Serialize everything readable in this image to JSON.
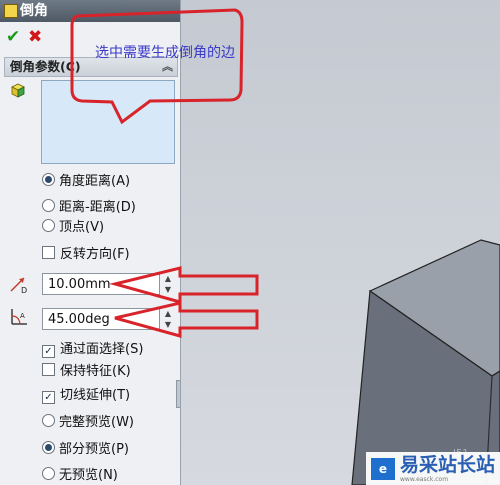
{
  "panel": {
    "title": "倒角",
    "ok_icon": "check-icon",
    "cancel_icon": "close-icon",
    "group_title": "倒角参数(C)",
    "collapse_icon": "double-chevron-up-icon",
    "edge_selection_icon": "cube-edge-icon",
    "type_options": [
      {
        "label": "角度距离(A)",
        "selected": true
      },
      {
        "label": "距离-距离(D)",
        "selected": false
      },
      {
        "label": "顶点(V)",
        "selected": false
      }
    ],
    "flip_direction": {
      "label": "反转方向(F)",
      "checked": false
    },
    "distance": {
      "value": "10.00mm",
      "icon": "distance-icon"
    },
    "angle": {
      "value": "45.00deg",
      "icon": "angle-icon"
    },
    "options": [
      {
        "label": "通过面选择(S)",
        "checked": true
      },
      {
        "label": "保持特征(K)",
        "checked": false
      },
      {
        "label": "切线延伸(T)",
        "checked": true
      }
    ],
    "preview_options": [
      {
        "label": "完整预览(W)",
        "selected": false
      },
      {
        "label": "部分预览(P)",
        "selected": true
      },
      {
        "label": "无预览(N)",
        "selected": false
      }
    ]
  },
  "annotation": {
    "callout_text": "选中需要生成倒角的边",
    "callout_color": "#d8232a",
    "text_color": "#3a3ac8"
  },
  "watermark": {
    "logo_text": "e",
    "name": "易采站长站",
    "url": "www.easck.com"
  }
}
